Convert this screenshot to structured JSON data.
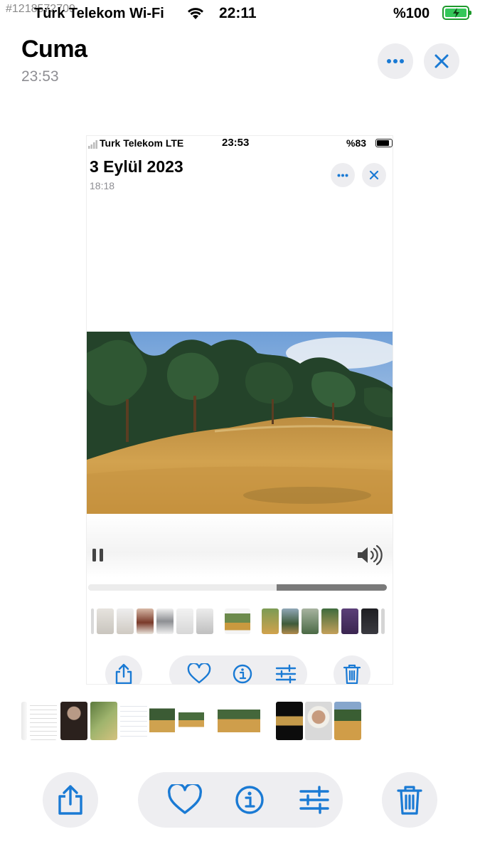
{
  "status_bar": {
    "watermark": "#1218572709",
    "carrier": "Türk Telekom Wi-Fi",
    "time": "22:11",
    "battery": "%100"
  },
  "header": {
    "title": "Cuma",
    "subtitle": "23:53"
  },
  "inner_screenshot": {
    "status_bar": {
      "carrier": "Turk Telekom  LTE",
      "time": "23:53",
      "battery": "%83",
      "battery_level": 0.83
    },
    "title": "3 Eylül 2023",
    "subtitle": "18:18",
    "video_progress": 0.63
  },
  "colors": {
    "accent": "#1a7ad4",
    "button_bg": "#eeeef1",
    "secondary_text": "#8e8e93"
  },
  "icons": {
    "more": "ellipsis-icon",
    "close": "close-icon",
    "share": "share-icon",
    "favorite": "heart-icon",
    "info": "info-icon",
    "edit": "sliders-icon",
    "delete": "trash-icon",
    "pause": "pause-icon",
    "volume": "speaker-icon"
  }
}
